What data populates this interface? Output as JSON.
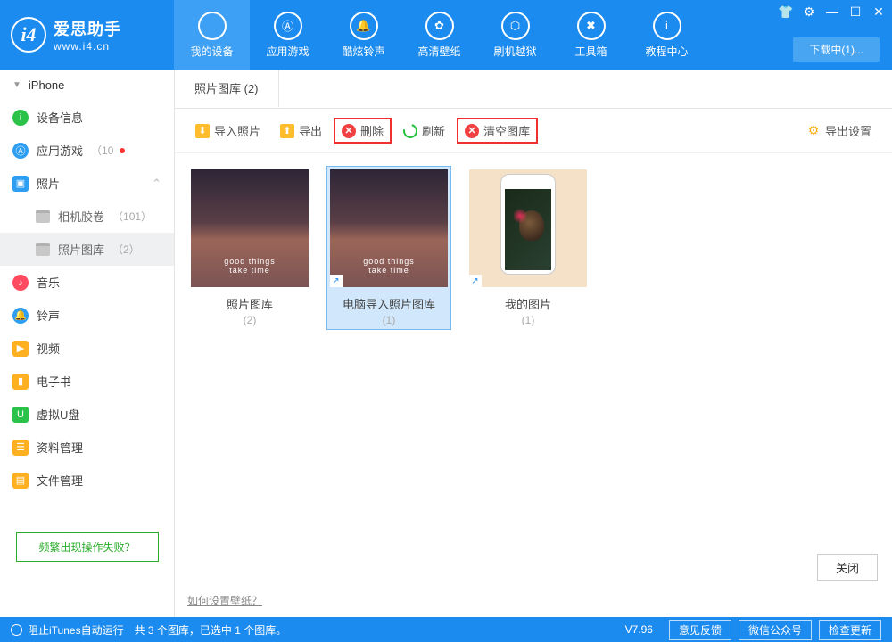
{
  "brand": {
    "title": "爱思助手",
    "url": "www.i4.cn",
    "badge": "i4"
  },
  "nav": [
    {
      "label": "我的设备",
      "glyph": ""
    },
    {
      "label": "应用游戏",
      "glyph": "Ⓐ"
    },
    {
      "label": "酷炫铃声",
      "glyph": "🔔"
    },
    {
      "label": "高清壁纸",
      "glyph": "✿"
    },
    {
      "label": "刷机越狱",
      "glyph": "⬡"
    },
    {
      "label": "工具箱",
      "glyph": "✖"
    },
    {
      "label": "教程中心",
      "glyph": "i"
    }
  ],
  "download_label": "下载中(1)...",
  "sidebar": {
    "head": "iPhone",
    "items": [
      {
        "label": "设备信息",
        "color": "#2bc24a",
        "glyph": "i"
      },
      {
        "label": "应用游戏",
        "color": "#2e9ef2",
        "glyph": "Ⓐ",
        "count": "（10",
        "badge": true
      },
      {
        "label": "照片",
        "color": "#2e9ef2",
        "glyph": "▣",
        "sq": true,
        "expand": true
      },
      {
        "label": "相机胶卷",
        "count": "（101）",
        "sub": true
      },
      {
        "label": "照片图库",
        "count": "（2）",
        "sub": true,
        "selected": true
      },
      {
        "label": "音乐",
        "color": "#ff4a60",
        "glyph": "♪"
      },
      {
        "label": "铃声",
        "color": "#2e9ef2",
        "glyph": "🔔"
      },
      {
        "label": "视频",
        "color": "#ffb020",
        "glyph": "▶",
        "sq": true
      },
      {
        "label": "电子书",
        "color": "#ffb020",
        "glyph": "▮",
        "sq": true
      },
      {
        "label": "虚拟U盘",
        "color": "#2bc24a",
        "glyph": "U",
        "sq": true
      },
      {
        "label": "资料管理",
        "color": "#ffb020",
        "glyph": "☰",
        "sq": true
      },
      {
        "label": "文件管理",
        "color": "#ffb020",
        "glyph": "▤",
        "sq": true
      }
    ],
    "help": "频繁出现操作失败？"
  },
  "tabs": [
    {
      "label": "照片图库 (2)"
    }
  ],
  "toolbar": {
    "import": "导入照片",
    "export": "导出",
    "delete": "删除",
    "refresh": "刷新",
    "clear": "清空图库",
    "settings": "导出设置"
  },
  "thumb_text": {
    "line1": "good things",
    "line2": "take time"
  },
  "cards": [
    {
      "title": "照片图库",
      "count": "(2)"
    },
    {
      "title": "电脑导入照片图库",
      "count": "(1)",
      "selected": true,
      "link": true
    },
    {
      "title": "我的图片",
      "count": "(1)",
      "link": true,
      "phone": true
    }
  ],
  "footlink": "如何设置壁纸？",
  "close": "关闭",
  "status": {
    "itunes": "阻止iTunes自动运行",
    "summary": "共 3 个图库，已选中 1 个图库。",
    "version": "V7.96",
    "btns": [
      "意见反馈",
      "微信公众号",
      "检查更新"
    ]
  }
}
